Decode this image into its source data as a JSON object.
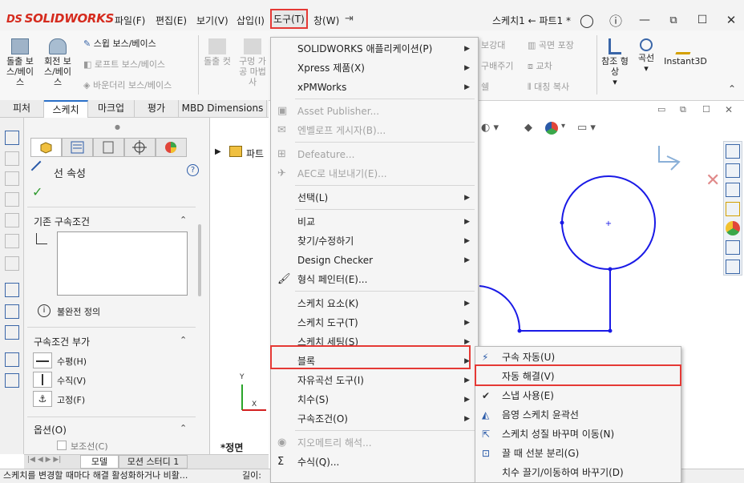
{
  "app": {
    "logo_prefix": "DS",
    "logo": "SOLIDWORKS",
    "window_title": "스케치1 ← 파트1 *"
  },
  "menubar": [
    "파일(F)",
    "편집(E)",
    "보기(V)",
    "삽입(I)",
    "도구(T)",
    "창(W)"
  ],
  "ribbon": {
    "extrude": "돌출 보스/베이스",
    "revolve": "회전 보스/베이스",
    "sweep": "스윕 보스/베이스",
    "loft": "로프트 보스/베이스",
    "boundary": "바운더리 보스/베이스",
    "extrude_cut": "돌출 컷",
    "hole_wizard": "구멍 가공 마법사",
    "fillet_partial": "보강대",
    "wrap_partial": "구배주기",
    "shell_partial": "쉘",
    "curve_pattern": "곡면 포장",
    "intersect": "교차",
    "mirror": "대칭 복사",
    "ref_geometry": "참조 형상",
    "curves": "곡선",
    "instant3d": "Instant3D"
  },
  "tabs": [
    "피처",
    "스케치",
    "마크업",
    "평가",
    "MBD Dimensions"
  ],
  "pm": {
    "title": "선 속성",
    "existing_relations": "기존 구속조건",
    "under_defined": "불완전 정의",
    "add_relations": "구속조건 부가",
    "horizontal": "수평(H)",
    "vertical": "수직(V)",
    "fix": "고정(F)",
    "options": "옵션(O)",
    "construction": "보조선(C)"
  },
  "tree": {
    "root": "파트"
  },
  "view": {
    "label": "*정면"
  },
  "tools_menu": {
    "items": [
      {
        "label": "SOLIDWORKS 애플리케이션(P)",
        "arrow": true,
        "icon": "",
        "disabled": false
      },
      {
        "label": "Xpress 제품(X)",
        "arrow": true,
        "icon": "",
        "disabled": false
      },
      {
        "label": "xPMWorks",
        "arrow": true,
        "icon": "",
        "disabled": false
      },
      {
        "sep": true
      },
      {
        "label": "Asset Publisher...",
        "arrow": false,
        "icon": "asset-icon",
        "disabled": true
      },
      {
        "label": "엔벨로프 게시자(B)...",
        "arrow": false,
        "icon": "envelope-icon",
        "disabled": true
      },
      {
        "sep": true
      },
      {
        "label": "Defeature...",
        "arrow": false,
        "icon": "defeature-icon",
        "disabled": true
      },
      {
        "label": "AEC로 내보내기(E)...",
        "arrow": false,
        "icon": "aec-icon",
        "disabled": true
      },
      {
        "sep": true
      },
      {
        "label": "선택(L)",
        "arrow": true,
        "icon": "",
        "disabled": false
      },
      {
        "sep": true
      },
      {
        "label": "비교",
        "arrow": true,
        "icon": "",
        "disabled": false
      },
      {
        "label": "찾기/수정하기",
        "arrow": true,
        "icon": "",
        "disabled": false
      },
      {
        "label": "Design Checker",
        "arrow": true,
        "icon": "",
        "disabled": false
      },
      {
        "label": "형식 페인터(E)...",
        "arrow": false,
        "icon": "format-painter-icon",
        "disabled": false
      },
      {
        "sep": true
      },
      {
        "label": "스케치 요소(K)",
        "arrow": true,
        "icon": "",
        "disabled": false
      },
      {
        "label": "스케치 도구(T)",
        "arrow": true,
        "icon": "",
        "disabled": false
      },
      {
        "label": "스케치 세팅(S)",
        "arrow": true,
        "icon": "",
        "disabled": false,
        "highlight": true
      },
      {
        "label": "블록",
        "arrow": true,
        "icon": "",
        "disabled": false
      },
      {
        "label": "자유곡선 도구(I)",
        "arrow": true,
        "icon": "",
        "disabled": false
      },
      {
        "label": "치수(S)",
        "arrow": true,
        "icon": "",
        "disabled": false
      },
      {
        "label": "구속조건(O)",
        "arrow": true,
        "icon": "",
        "disabled": false
      },
      {
        "sep": true
      },
      {
        "label": "지오메트리 해석...",
        "arrow": false,
        "icon": "geometry-icon",
        "disabled": true
      },
      {
        "label": "수식(Q)...",
        "arrow": false,
        "icon": "sigma-icon",
        "disabled": false
      }
    ]
  },
  "sketch_settings_menu": {
    "items": [
      {
        "label": "구속 자동(U)",
        "icon": "auto-relations-icon"
      },
      {
        "label": "자동 해결(V)",
        "icon": "",
        "highlight": true
      },
      {
        "label": "스냅 사용(E)",
        "icon": "check-icon"
      },
      {
        "label": "음영 스케치 윤곽선",
        "icon": "shaded-contour-icon"
      },
      {
        "label": "스케치 성질 바꾸며 이동(N)",
        "icon": "move-drag-icon"
      },
      {
        "label": "끌 때 선분 분리(G)",
        "icon": "split-icon"
      },
      {
        "label": "치수 끌기/이동하여 바꾸기(D)",
        "icon": ""
      }
    ]
  },
  "bottom_tabs": [
    "모델",
    "모션 스터디 1"
  ],
  "status": {
    "message": "스케치를 변경할 때마다 해결 활성화하거나 비활...",
    "length_label": "길이:"
  },
  "colors": {
    "accent": "#2a6fc9",
    "highlight": "#e53935",
    "sketch": "#1a1ae6"
  }
}
